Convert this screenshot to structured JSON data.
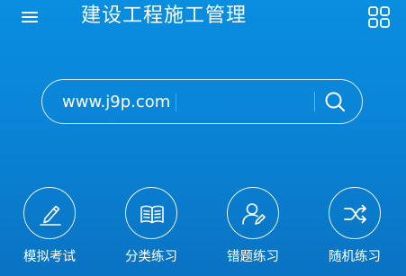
{
  "header": {
    "title": "建设工程施工管理",
    "menu_icon": "hamburger-menu-icon",
    "apps_icon": "grid-apps-icon"
  },
  "search": {
    "value": "www.j9p.com",
    "search_icon": "search-icon"
  },
  "features": [
    {
      "label": "模拟考试",
      "icon": "pencil-icon"
    },
    {
      "label": "分类练习",
      "icon": "open-book-icon"
    },
    {
      "label": "错题练习",
      "icon": "user-edit-icon"
    },
    {
      "label": "随机练习",
      "icon": "shuffle-icon"
    }
  ],
  "colors": {
    "background_top": "#0a8ee0",
    "background_bottom": "#0a73c3",
    "foreground": "#ffffff",
    "caret": "#1ec0e8"
  }
}
